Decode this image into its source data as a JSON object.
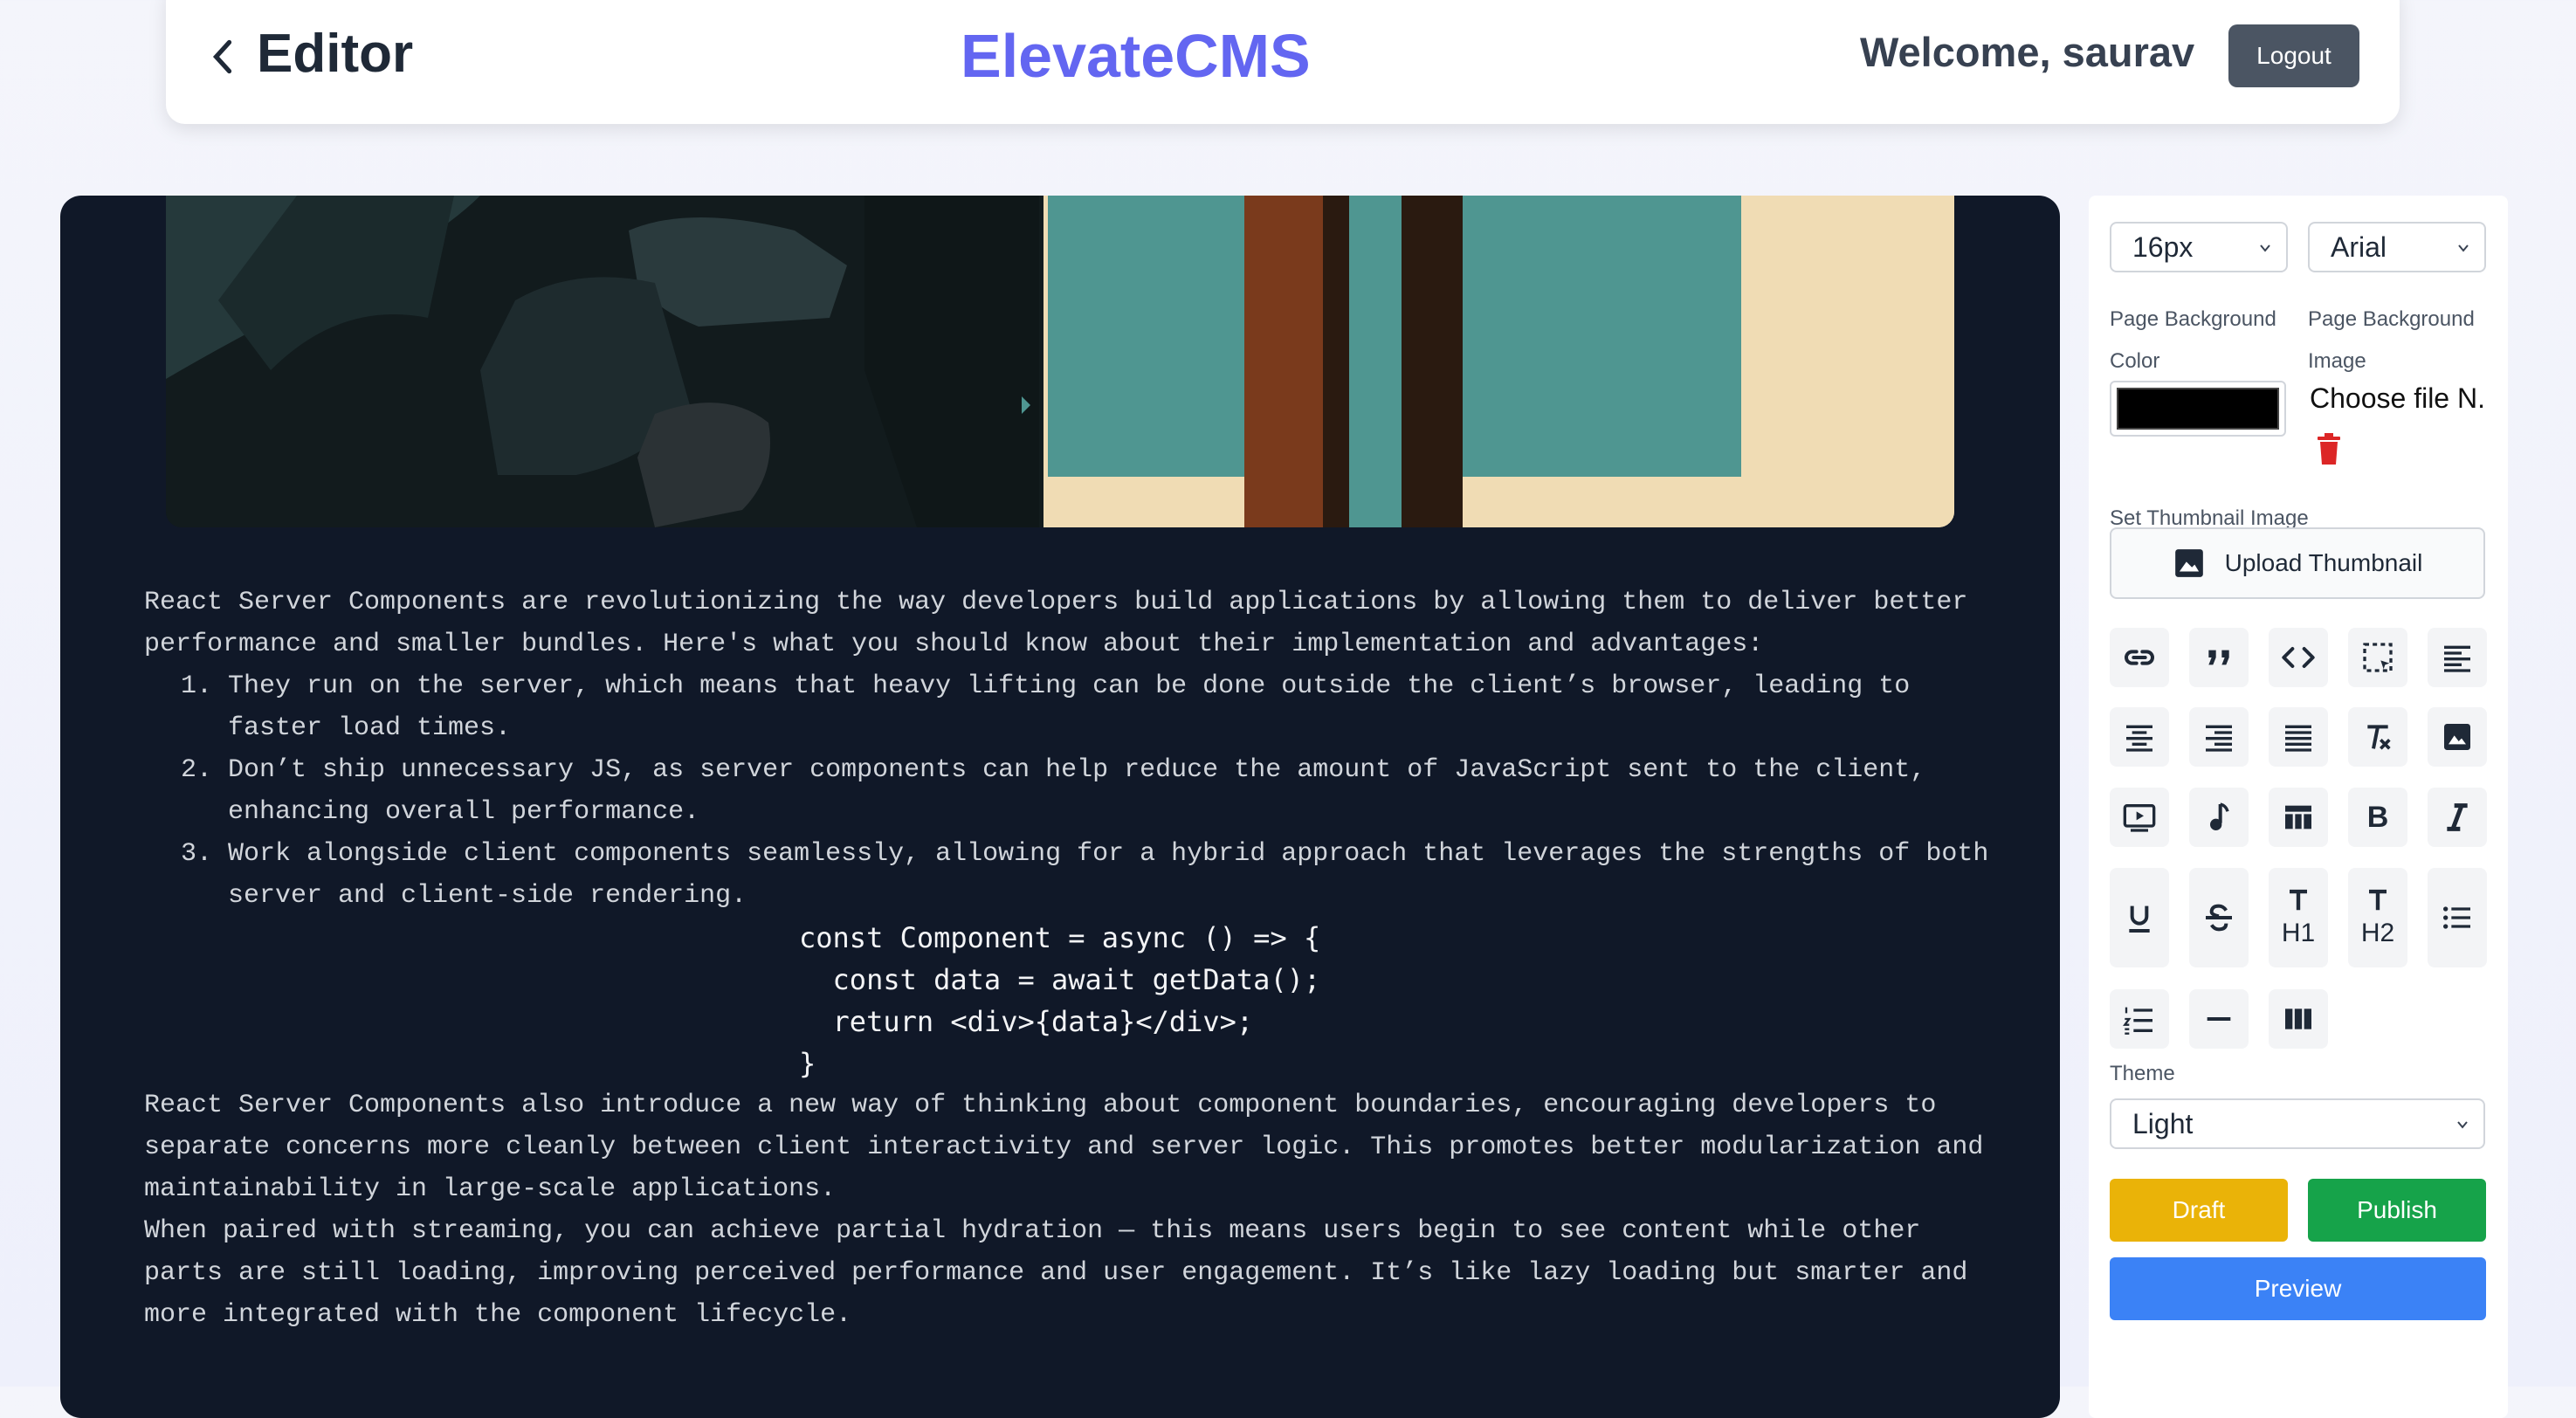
{
  "header": {
    "title": "Editor",
    "brand": "ElevateCMS",
    "welcome": "Welcome, saurav",
    "logout_label": "Logout"
  },
  "article": {
    "intro": "React Server Components are revolutionizing the way developers build applications by allowing them to deliver better performance and smaller bundles. Here's what you should know about their implementation and advantages:",
    "list": [
      "They run on the server, which means that heavy lifting can be done outside the client’s browser, leading to faster load times.",
      "Don’t ship unnecessary JS, as server components can help reduce the amount of JavaScript sent to the client, enhancing overall performance.",
      "Work alongside client components seamlessly, allowing for a hybrid approach that leverages the strengths of both server and client-side rendering."
    ],
    "code": [
      "const Component = async () => {",
      "  const data = await getData();",
      "  return <div>{data}</div>;",
      "}"
    ],
    "para2": "React Server Components also introduce a new way of thinking about component boundaries, encouraging developers to separate concerns more cleanly between client interactivity and server logic. This promotes better modularization and maintainability in large-scale applications.",
    "para3": "When paired with streaming, you can achieve partial hydration — this means users begin to see content while other parts are still loading, improving perceived performance and user engagement. It’s like lazy loading but smarter and more integrated with the component lifecycle."
  },
  "sidebar": {
    "font_size": "16px",
    "font_family": "Arial",
    "bg_color_label": "Page Background Color",
    "bg_color_value": "#000000",
    "bg_image_label": "Page Background Image",
    "file_button": "Choose file N.",
    "thumbnail_label": "Set Thumbnail Image",
    "upload_label": "Upload Thumbnail",
    "heading1_sub": "H1",
    "heading2_sub": "H2",
    "bold_label": "B",
    "theme_label": "Theme",
    "theme_value": "Light",
    "draft_label": "Draft",
    "publish_label": "Publish",
    "preview_label": "Preview"
  },
  "colors": {
    "brand": "#6366f1",
    "editor_bg": "#101828",
    "draft": "#eab308",
    "publish": "#16a34a",
    "preview": "#3b82f6",
    "delete": "#dc2626"
  }
}
